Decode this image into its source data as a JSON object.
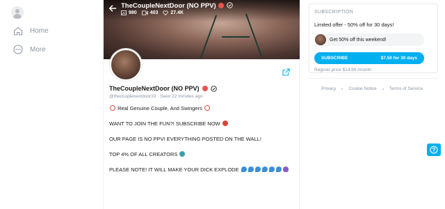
{
  "nav": {
    "home_label": "Home",
    "more_label": "More"
  },
  "cover": {
    "title": "TheCoupleNextDoor (NO PPV)",
    "photos_count": "980",
    "videos_count": "403",
    "likes_count": "27.4K"
  },
  "profile": {
    "name": "TheCoupleNextDoor (NO PPV)",
    "handle": "@thecouplenextdoor33",
    "seen": "Seen  22 minutes ago",
    "bio": {
      "line1": "Real Genuine Couple, And Swingers",
      "line2": "WANT TO JOIN THE FUN?! SUBSCRIBE NOW",
      "line3": "OUR PAGE IS NO PPV! EVERYTHING POSTED ON THE WALL!",
      "line4": "TOP 4% OF ALL CREATORS",
      "line5": "PLEASE NOTE! IT WILL MAKE YOUR DICK EXPLODE"
    }
  },
  "subscription": {
    "header": "SUBSCRIPTION",
    "offer": "Limited offer - 50% off for 30 days!",
    "promo": "Get 50% off this weekend!",
    "button_label": "SUBSCRIBE",
    "button_price": "$7.50 for 30 days",
    "regular_price": "Regular price $14.99 /month"
  },
  "footer": {
    "privacy": "Privacy",
    "cookie": "Cookie Notice",
    "terms": "Terms of Service"
  },
  "colors": {
    "accent": "#00aff0",
    "muted": "#8a96a3"
  }
}
